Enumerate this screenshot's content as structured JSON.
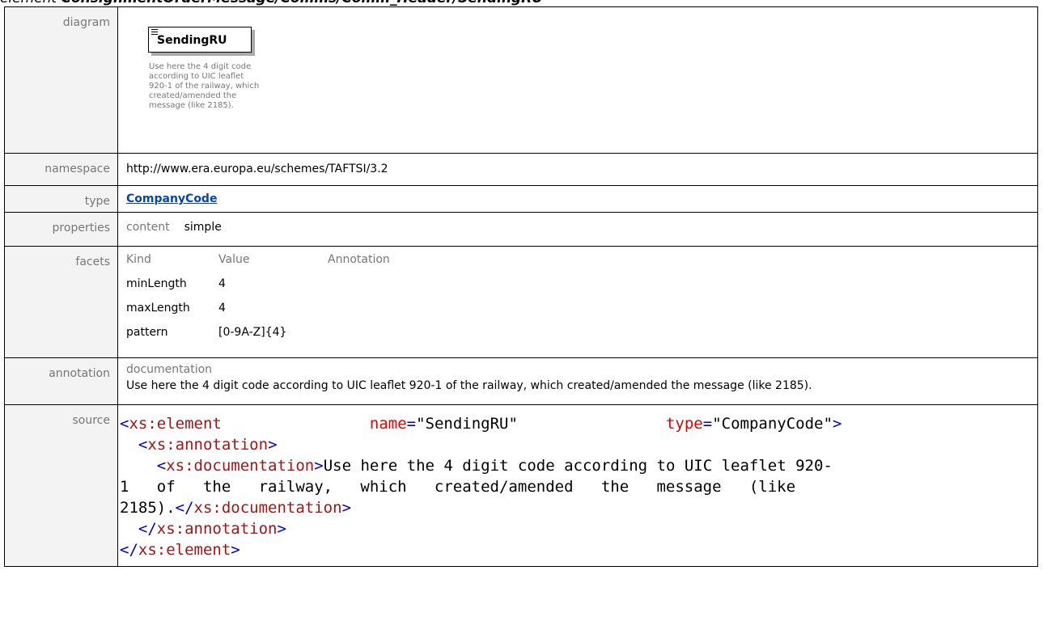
{
  "page_title": {
    "prefix": "element",
    "path": "ConsignmentOrderMessage/Comms/Comm_Header/SendingRU"
  },
  "diagram": {
    "label": "diagram",
    "element_name": "SendingRU",
    "documentation_lines": [
      "Use here the 4 digit code",
      "according to UIC leaflet",
      "920-1 of the railway, which",
      "created/amended the",
      "message (like 2185)."
    ]
  },
  "namespace": {
    "label": "namespace",
    "value": "http://www.era.europa.eu/schemes/TAFTSI/3.2"
  },
  "type": {
    "label": "type",
    "value": "CompanyCode"
  },
  "properties": {
    "label": "properties",
    "key": "content",
    "value": "simple"
  },
  "facets": {
    "label": "facets",
    "headers": [
      "Kind",
      "Value",
      "Annotation"
    ],
    "rows": [
      {
        "kind": "minLength",
        "value": "4"
      },
      {
        "kind": "maxLength",
        "value": "4"
      },
      {
        "kind": "pattern",
        "value": "[0-9A-Z]{4}"
      }
    ]
  },
  "annotation": {
    "label": "annotation",
    "sub": "documentation",
    "text": "Use here the 4 digit code according to UIC leaflet 920-1 of the railway, which created/amended the message (like 2185)."
  },
  "source": {
    "label": "source",
    "element_tag": "xs:element",
    "name_attr": "name",
    "name_val": "\"SendingRU\"",
    "type_attr": "type",
    "type_val": "\"CompanyCode\"",
    "annotation_tag": "xs:annotation",
    "documentation_tag": "xs:documentation",
    "doc_line1": "Use here the 4 digit code according to UIC leaflet 920-",
    "doc_line2": "1   of   the   railway,   which   created/amended   the   message   (like",
    "doc_line3": "2185)."
  },
  "colors": {
    "label_bg": "#f3f3f3",
    "label_text": "#777777",
    "link": "#0645ad",
    "xml_tag": "#0000d6",
    "xml_name": "#a31515",
    "xml_attr": "#e00000"
  }
}
